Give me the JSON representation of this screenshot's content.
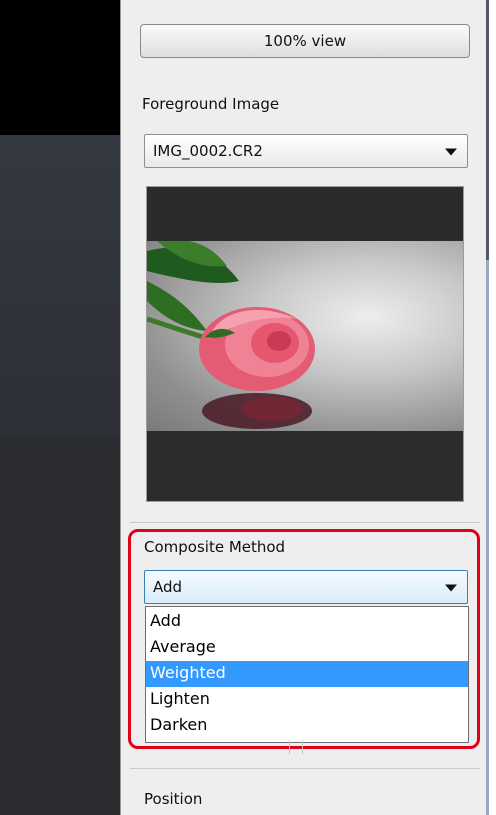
{
  "toolbar": {
    "view_button_label": "100% view"
  },
  "foreground": {
    "label": "Foreground Image",
    "selected_file": "IMG_0002.CR2"
  },
  "composite": {
    "label": "Composite Method",
    "selected": "Add",
    "options": [
      "Add",
      "Average",
      "Weighted",
      "Lighten",
      "Darken"
    ],
    "highlighted_option": "Weighted"
  },
  "position": {
    "label": "Position"
  },
  "colors": {
    "selection": "#3399ff",
    "annotation_outline": "#e0001a"
  }
}
